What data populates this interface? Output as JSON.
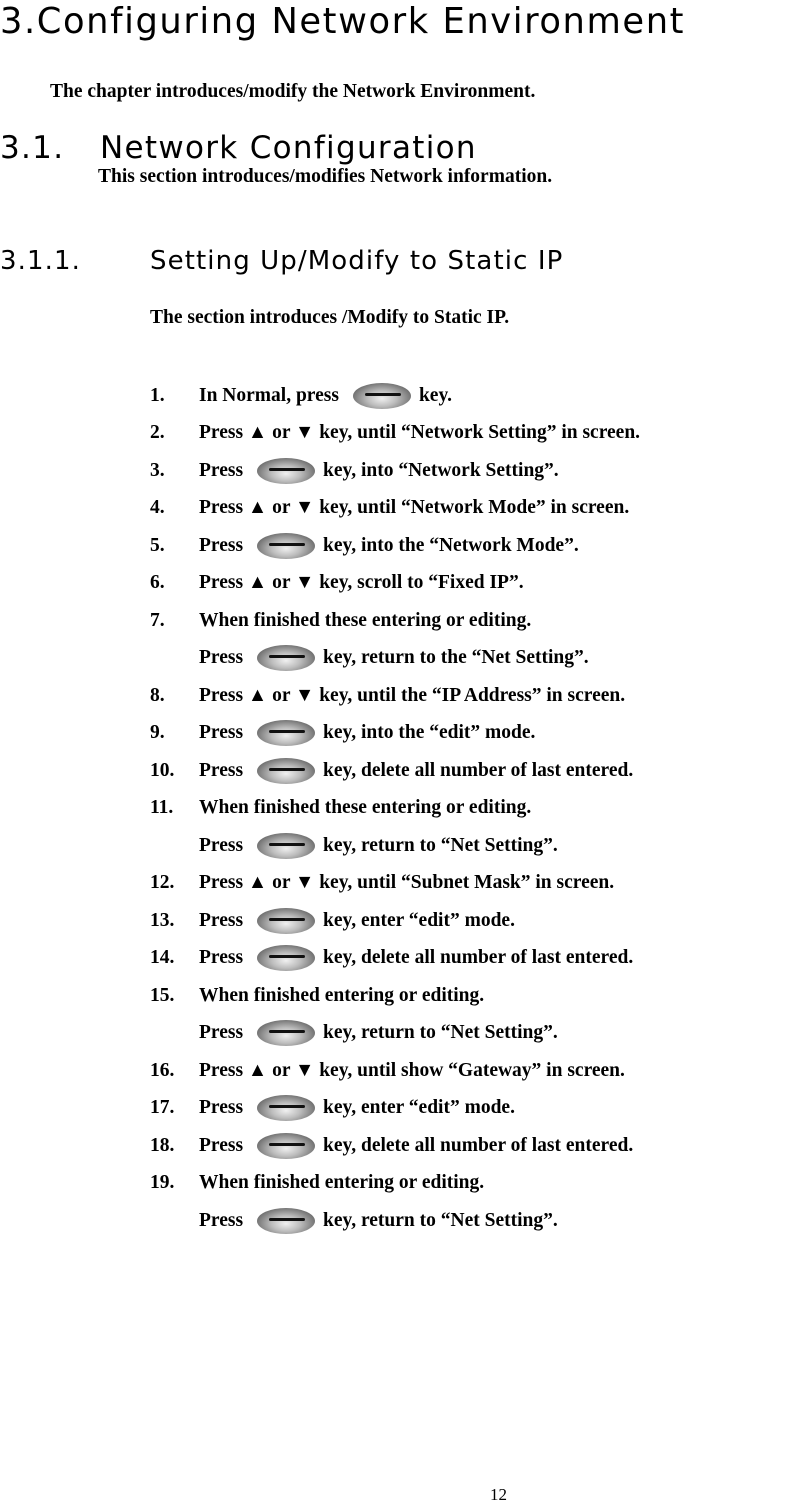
{
  "chapter": {
    "heading": "3.Configuring Network Environment",
    "intro": "The chapter introduces/modify the Network Environment."
  },
  "section": {
    "number": "3.1.",
    "title": "Network Configuration",
    "intro": "This section introduces/modifies Network information."
  },
  "subsection": {
    "number": "3.1.1.",
    "title": "Setting Up/Modify to Static IP",
    "intro": "The section introduces /Modify to Static IP."
  },
  "key_icon": "oval-key-button-icon",
  "steps": [
    {
      "num": "1.",
      "before": "In Normal, press",
      "key": true,
      "after": "key."
    },
    {
      "num": "2.",
      "text": "Press ▲ or ▼ key, until “Network Setting” in screen."
    },
    {
      "num": "3.",
      "before": "Press",
      "key": true,
      "after": "key, into “Network Setting”."
    },
    {
      "num": "4.",
      "text": "Press ▲ or ▼ key, until “Network Mode” in screen."
    },
    {
      "num": "5.",
      "before": "Press",
      "key": true,
      "after": "key, into the “Network Mode”."
    },
    {
      "num": "6.",
      "text": "Press ▲ or ▼ key, scroll to “Fixed IP”."
    },
    {
      "num": "7.",
      "text": "When finished these entering or editing."
    },
    {
      "num": "",
      "before": "Press",
      "key": true,
      "after": "key, return to the “Net Setting”."
    },
    {
      "num": "8.",
      "text": "Press ▲ or ▼ key, until the “IP Address” in screen."
    },
    {
      "num": "9.",
      "before": "Press",
      "key": true,
      "after": "key, into the “edit” mode."
    },
    {
      "num": "10.",
      "before": "Press",
      "key": true,
      "after": "key, delete all number of last entered."
    },
    {
      "num": "11.",
      "text": "When finished these entering or editing."
    },
    {
      "num": "",
      "before": "Press",
      "key": true,
      "after": "key, return to “Net Setting”."
    },
    {
      "num": "12.",
      "text": "Press ▲ or ▼ key, until “Subnet Mask” in screen."
    },
    {
      "num": "13.",
      "before": "Press",
      "key": true,
      "after": "key, enter “edit” mode."
    },
    {
      "num": "14.",
      "before": "Press",
      "key": true,
      "after": "key, delete all number of last entered."
    },
    {
      "num": "15.",
      "text": "When finished entering or editing."
    },
    {
      "num": "",
      "before": "Press",
      "key": true,
      "after": "key, return to “Net Setting”."
    },
    {
      "num": "16.",
      "text": "Press ▲ or ▼ key, until show “Gateway” in screen."
    },
    {
      "num": "17.",
      "before": "Press",
      "key": true,
      "after": "key, enter “edit” mode."
    },
    {
      "num": "18.",
      "before": "Press",
      "key": true,
      "after": "key, delete all number of last entered."
    },
    {
      "num": "19.",
      "text": "When finished entering or editing."
    },
    {
      "num": "",
      "before": "Press",
      "key": true,
      "after": "key, return to “Net Setting”."
    }
  ],
  "page_number": "12"
}
